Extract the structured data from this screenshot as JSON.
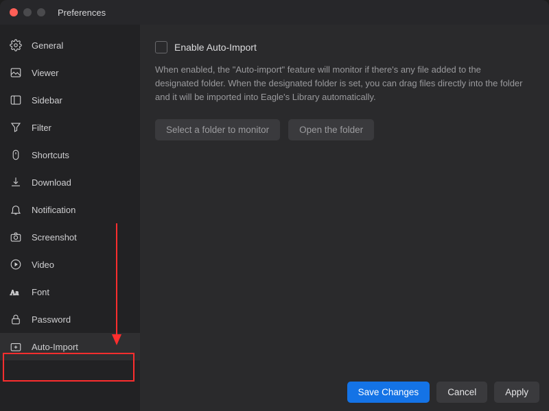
{
  "window": {
    "title": "Preferences"
  },
  "sidebar": {
    "items": [
      {
        "label": "General"
      },
      {
        "label": "Viewer"
      },
      {
        "label": "Sidebar"
      },
      {
        "label": "Filter"
      },
      {
        "label": "Shortcuts"
      },
      {
        "label": "Download"
      },
      {
        "label": "Notification"
      },
      {
        "label": "Screenshot"
      },
      {
        "label": "Video"
      },
      {
        "label": "Font"
      },
      {
        "label": "Password"
      },
      {
        "label": "Auto-Import"
      }
    ]
  },
  "main": {
    "checkbox_label": "Enable Auto-Import",
    "description": "When enabled, the \"Auto-import\" feature will monitor if there's any file added to the designated folder. When the designated folder is set, you can drag files directly into the folder and it will be imported into Eagle's Library automatically.",
    "select_folder_label": "Select a folder to monitor",
    "open_folder_label": "Open the folder"
  },
  "footer": {
    "save": "Save Changes",
    "cancel": "Cancel",
    "apply": "Apply"
  }
}
